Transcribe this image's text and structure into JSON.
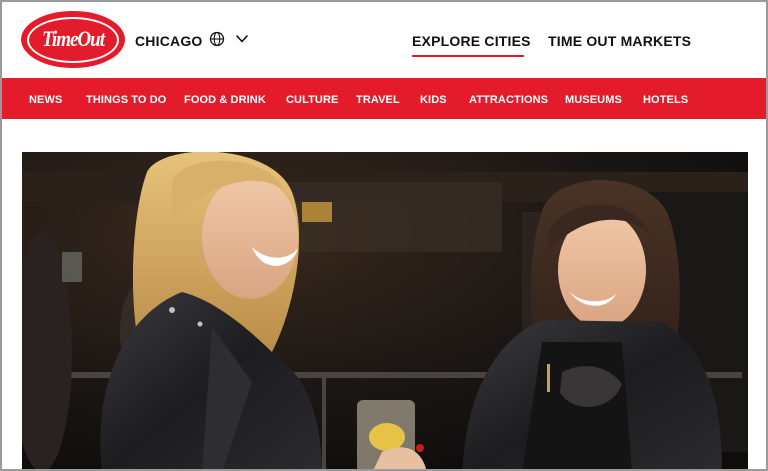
{
  "header": {
    "logo_text": "TimeOut",
    "city": "CHICAGO",
    "globe_icon": "globe-icon",
    "chevron_icon": "chevron-down-icon",
    "explore": "EXPLORE CITIES",
    "markets": "TIME OUT MARKETS"
  },
  "nav": {
    "items": [
      "NEWS",
      "THINGS TO DO",
      "FOOD & DRINK",
      "CULTURE",
      "TRAVEL",
      "KIDS",
      "ATTRACTIONS",
      "MUSEUMS",
      "HOTELS"
    ]
  },
  "hero": {
    "description": ""
  },
  "colors": {
    "brand_red": "#e31b2b",
    "text_dark": "#111111"
  }
}
